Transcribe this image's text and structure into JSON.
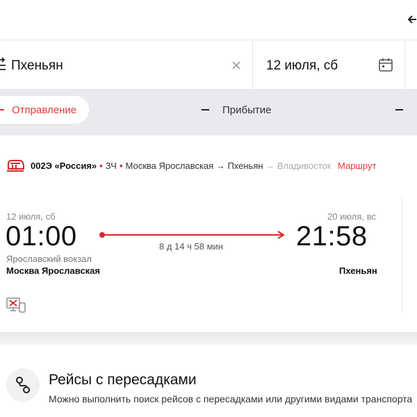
{
  "search": {
    "destination": "Пхеньян",
    "date": "12 июля, сб"
  },
  "sort": {
    "departure_label": "Отправление",
    "arrival_label": "Прибытие"
  },
  "train": {
    "number": "002Э «Россия»",
    "car_type": "ЗЧ",
    "from": "Москва Ярославская",
    "to": "Пхеньян",
    "via": "Владивосток",
    "route_link": "Маршрут",
    "departure": {
      "date": "12 июля, сб",
      "time": "01:00",
      "terminal": "Ярославский вокзал",
      "station": "Москва Ярославская"
    },
    "arrival": {
      "date": "20 июля, вс",
      "time": "21:58",
      "station": "Пхеньян"
    },
    "duration": "8 д 14 ч 58 мин"
  },
  "promo": {
    "title": "Рейсы с пересадками",
    "text": "Можно выполнить поиск рейсов с пересадками или другими видами транспорта"
  },
  "colors": {
    "accent": "#e03a3a",
    "brand_red": "#d6262b",
    "sort_bg": "#e9eaed"
  },
  "icons": {
    "swap": "swap-icon",
    "clear": "close-icon",
    "calendar": "calendar-icon",
    "train": "train-icon",
    "no_online": "no-online-purchase-icon",
    "transfer": "route-transfer-icon"
  }
}
